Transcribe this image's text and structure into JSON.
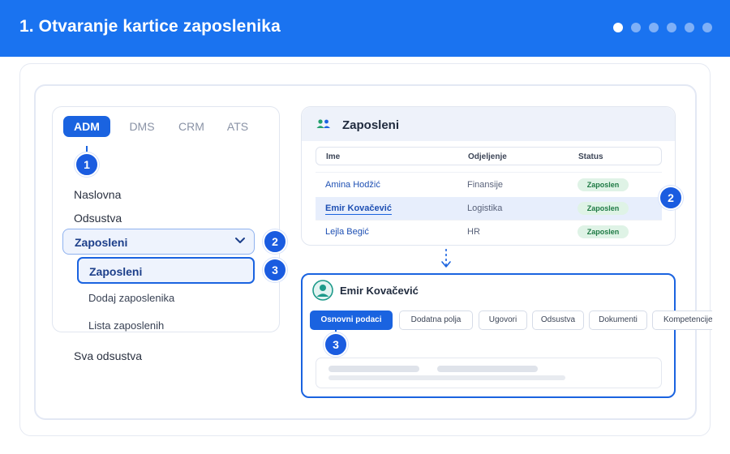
{
  "header": {
    "title": "1. Otvaranje kartice zaposlenika",
    "dots_total": 6,
    "dots_active_index": 0
  },
  "modules": {
    "tabs": [
      "ADM",
      "DMS",
      "CRM",
      "ATS"
    ],
    "active": "ADM"
  },
  "steps": {
    "one": "1",
    "two": "2",
    "three": "3"
  },
  "sidebar": {
    "items": [
      "Naslovna",
      "Odsustva"
    ],
    "group_label": "Zaposleni",
    "sub_items": [
      "Zaposleni",
      "Dodaj zaposlenika",
      "Lista zaposlenih"
    ],
    "bottom_item": "Sva odsustva"
  },
  "employees": {
    "title": "Zaposleni",
    "columns": [
      "Ime",
      "Odjeljenje",
      "Status"
    ],
    "rows": [
      {
        "name": "Amina Hodžić",
        "dept": "Finansije",
        "status": "Zaposlen"
      },
      {
        "name": "Emir Kovačević",
        "dept": "Logistika",
        "status": "Zaposlen"
      },
      {
        "name": "Lejla Begić",
        "dept": "HR",
        "status": "Zaposlen"
      }
    ],
    "selected_row_index": 1
  },
  "detail": {
    "name": "Emir Kovačević",
    "tabs": [
      "Osnovni podaci",
      "Dodatna polja",
      "Ugovori",
      "Odsustva",
      "Dokumenti",
      "Kompetencije"
    ],
    "active_tab": "Osnovni podaci"
  },
  "colors": {
    "primary": "#1a63e0",
    "header": "#1a73f0",
    "status_bg": "#dff3e6",
    "status_text": "#1e7a44"
  }
}
